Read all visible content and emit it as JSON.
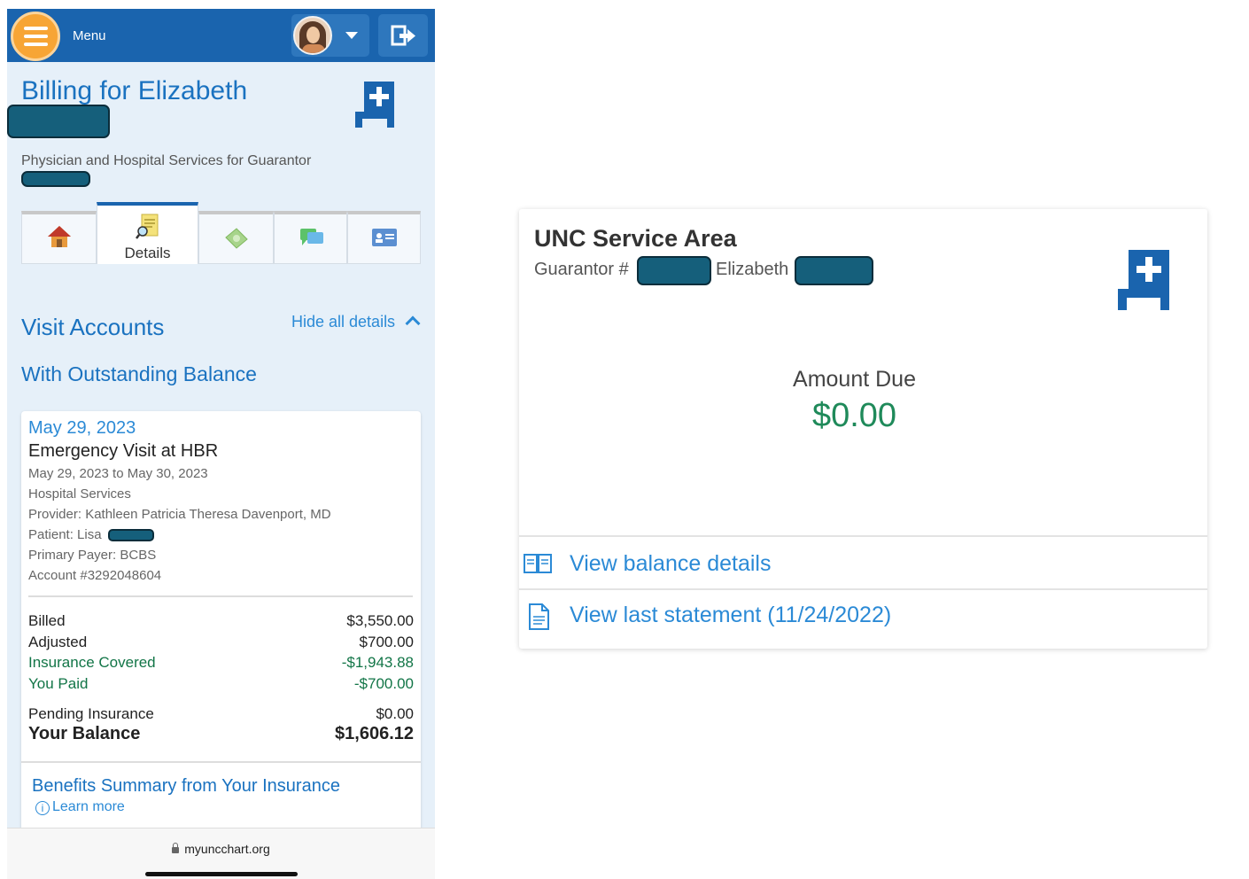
{
  "header": {
    "menu_label": "Menu"
  },
  "billing": {
    "title": "Billing for Elizabeth",
    "subtitle": "Physician and Hospital Services for Guarantor"
  },
  "tabs": [
    {
      "label": "",
      "icon": "home-icon"
    },
    {
      "label": "Details",
      "icon": "document-search-icon",
      "active": true
    },
    {
      "label": "",
      "icon": "money-icon"
    },
    {
      "label": "",
      "icon": "chat-icon"
    },
    {
      "label": "",
      "icon": "id-card-icon"
    }
  ],
  "visits": {
    "heading": "Visit Accounts",
    "hide_all": "Hide all details",
    "outstanding": "With Outstanding Balance"
  },
  "account": {
    "date": "May 29, 2023",
    "visit": "Emergency Visit at HBR",
    "range": "May 29, 2023 to May 30, 2023",
    "type": "Hospital Services",
    "provider": "Provider: Kathleen Patricia Theresa Davenport, MD",
    "patient": "Patient: Lisa",
    "payer": "Primary Payer: BCBS",
    "account_number": "Account #3292048604",
    "rows": [
      {
        "label": "Billed",
        "value": "$3,550.00"
      },
      {
        "label": "Adjusted",
        "value": "$700.00"
      },
      {
        "label": "Insurance Covered",
        "value": "-$1,943.88"
      },
      {
        "label": "You Paid",
        "value": "-$700.00"
      },
      {
        "label": "Pending Insurance",
        "value": "$0.00"
      },
      {
        "label": "Your Balance",
        "value": "$1,606.12"
      }
    ],
    "benefits": "Benefits Summary from Your Insurance",
    "learn_more": "Learn more"
  },
  "browser": {
    "url": "myuncchart.org"
  },
  "service_area": {
    "title": "UNC Service Area",
    "guarantor_label": "Guarantor #",
    "guarantor_name": "Elizabeth",
    "amount_label": "Amount Due",
    "amount_value": "$0.00",
    "link_balance": "View balance details",
    "link_statement": "View last statement (11/24/2022)"
  },
  "colors": {
    "header_blue": "#1a64ae",
    "link_blue": "#2b8ad6",
    "title_blue": "#1a72c0",
    "green": "#127547",
    "amount_green": "#1f8a5a",
    "menu_orange": "#f7a535",
    "redaction": "#155f7b"
  }
}
